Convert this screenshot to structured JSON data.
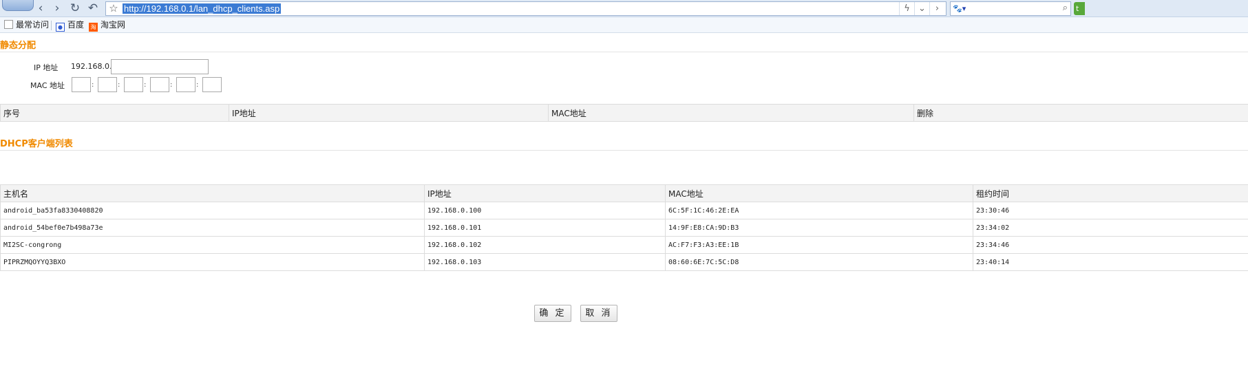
{
  "browser": {
    "url": "http://192.168.0.1/lan_dhcp_clients.asp",
    "bookmarks": [
      {
        "label": "最常访问"
      },
      {
        "label": "百度"
      },
      {
        "label": "淘宝网"
      }
    ],
    "bookmark_badge": "淘",
    "search_badge": "🐾▾",
    "ext_badge": "t"
  },
  "static": {
    "title": "静态分配",
    "ip_label": "IP 地址",
    "ip_prefix": "192.168.0.",
    "mac_label": "MAC 地址",
    "mac_separator": ":",
    "columns": [
      "序号",
      "IP地址",
      "MAC地址",
      "删除"
    ]
  },
  "dhcp": {
    "title": "DHCP客户端列表",
    "columns": [
      "主机名",
      "IP地址",
      "MAC地址",
      "租约时间"
    ],
    "rows": [
      [
        "android_ba53fa8330408820",
        "192.168.0.100",
        "6C:5F:1C:46:2E:EA",
        "23:30:46"
      ],
      [
        "android_54bef0e7b498a73e",
        "192.168.0.101",
        "14:9F:E8:CA:9D:B3",
        "23:34:02"
      ],
      [
        "MI2SC-congrong",
        "192.168.0.102",
        "AC:F7:F3:A3:EE:1B",
        "23:34:46"
      ],
      [
        "PIPRZMQOYYQ3BXO",
        "192.168.0.103",
        "08:60:6E:7C:5C:D8",
        "23:40:14"
      ]
    ]
  },
  "buttons": {
    "ok": "确 定",
    "cancel": "取 消"
  }
}
